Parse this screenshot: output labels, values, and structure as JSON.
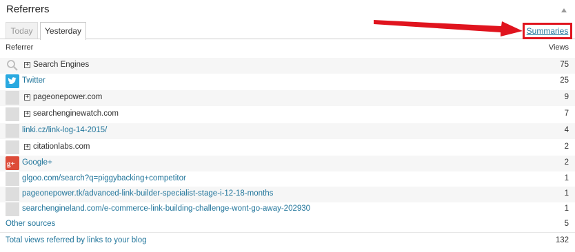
{
  "header": {
    "title": "Referrers"
  },
  "tabs": [
    {
      "label": "Today"
    },
    {
      "label": "Yesterday"
    }
  ],
  "summaries_label": "Summaries",
  "columns": {
    "referrer": "Referrer",
    "views": "Views"
  },
  "rows": [
    {
      "label": "Search Engines",
      "views": "75",
      "icon": "search-icon",
      "expandable": true
    },
    {
      "label": "Twitter",
      "views": "25",
      "icon": "twitter-icon",
      "expandable": false
    },
    {
      "label": "pageonepower.com",
      "views": "9",
      "icon": "blank",
      "expandable": true
    },
    {
      "label": "searchenginewatch.com",
      "views": "7",
      "icon": "blank",
      "expandable": true
    },
    {
      "label": "linki.cz/link-log-14-2015/",
      "views": "4",
      "icon": "blank",
      "expandable": false
    },
    {
      "label": "citationlabs.com",
      "views": "2",
      "icon": "blank",
      "expandable": true
    },
    {
      "label": "Google+",
      "views": "2",
      "icon": "google-plus-icon",
      "expandable": false
    },
    {
      "label": "glgoo.com/search?q=piggybacking+competitor",
      "views": "1",
      "icon": "blank",
      "expandable": false
    },
    {
      "label": "pageonepower.tk/advanced-link-builder-specialist-stage-i-12-18-months",
      "views": "1",
      "icon": "blank",
      "expandable": false
    },
    {
      "label": "searchengineland.com/e-commerce-link-building-challenge-wont-go-away-202930",
      "views": "1",
      "icon": "blank",
      "expandable": false
    }
  ],
  "other": {
    "label": "Other sources",
    "views": "5"
  },
  "total": {
    "label": "Total views referred by links to your blog",
    "views": "132"
  },
  "colors": {
    "link": "#21759b",
    "highlight": "#e0141e",
    "twitter": "#2aa9e0",
    "google_plus": "#dd4b39"
  }
}
